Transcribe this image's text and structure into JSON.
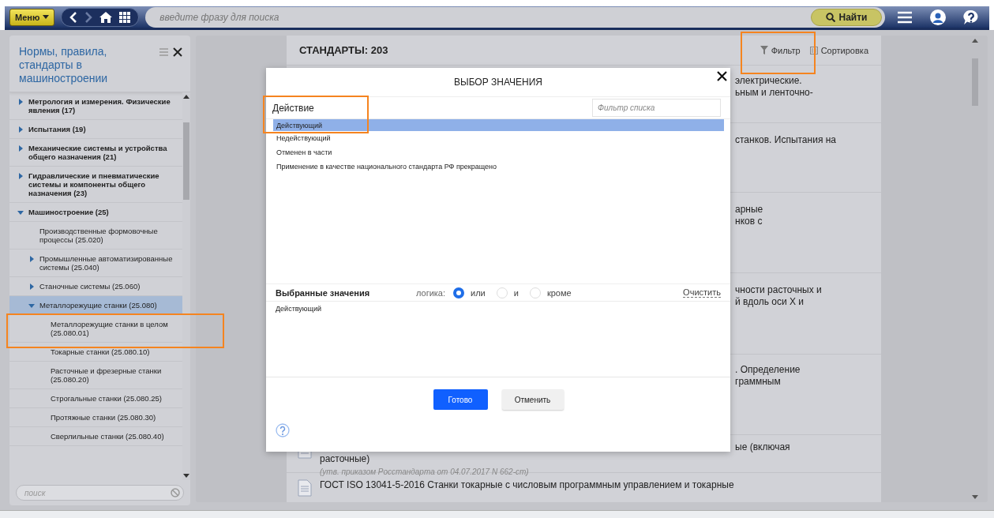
{
  "topbar": {
    "menu_label": "Меню",
    "search": {
      "placeholder": "введите фразу для поиска"
    },
    "find_label": "Найти"
  },
  "sidebar": {
    "title": "Нормы, правила, стандарты в машиностроении",
    "search": {
      "placeholder": "поиск"
    },
    "items": [
      {
        "label": "Метрология и измерения. Физические явления (17)",
        "expanded": false,
        "selected": false
      },
      {
        "label": "Испытания (19)",
        "expanded": false,
        "selected": false
      },
      {
        "label": "Механические системы и устройства общего назначения (21)",
        "expanded": false,
        "selected": false
      },
      {
        "label": "Гидравлические и пневматические системы и компоненты общего назначения (23)",
        "expanded": false,
        "selected": false
      },
      {
        "label": "Машиностроение (25)",
        "expanded": true,
        "selected": false,
        "children": [
          {
            "label": "Производственные формовочные процессы (25.020)",
            "selected": false
          },
          {
            "label": "Промышленные автоматизированные системы (25.040)",
            "expanded": false,
            "selected": false
          },
          {
            "label": "Станочные системы (25.060)",
            "expanded": false,
            "selected": false
          },
          {
            "label": "Металлорежущие станки (25.080)",
            "expanded": true,
            "selected": true,
            "children": [
              {
                "label": "Металлорежущие станки в целом (25.080.01)",
                "selected": false
              },
              {
                "label": "Токарные станки (25.080.10)",
                "selected": false
              },
              {
                "label": "Расточные и фрезерные станки (25.080.20)",
                "selected": false
              },
              {
                "label": "Строгальные станки (25.080.25)",
                "selected": false
              },
              {
                "label": "Протяжные станки (25.080.30)",
                "selected": false
              },
              {
                "label": "Сверлильные станки (25.080.40)",
                "selected": false
              }
            ]
          }
        ]
      }
    ]
  },
  "list": {
    "title": "СТАНДАРТЫ: 203",
    "filter_label": "Фильтр",
    "sort_label": "Сортировка",
    "rows": [
      {
        "fragment_lines": [
          "электрические.",
          "ьным и ленточно-"
        ]
      },
      {
        "fragment_lines": [
          "станков. Испытания на"
        ]
      },
      {
        "fragment_lines": [
          "арные",
          "нков с"
        ]
      },
      {
        "fragment_lines": [
          "чности расточных и",
          "й вдоль оси X и"
        ]
      },
      {
        "fragment_lines": [
          ". Определение",
          "граммным"
        ]
      },
      {
        "fragment_lines": [
          "ые (включая"
        ],
        "title": "расточные)",
        "note": "(утв. приказом Росстандарта от 04.07.2017 N 662-ст)"
      },
      {
        "title": "ГОСТ ISO 13041-5-2016 Станки токарные с числовым программным управлением и токарные"
      }
    ]
  },
  "dialog": {
    "title": "ВЫБОР ЗНАЧЕНИЯ",
    "field_label": "Действие",
    "filter": {
      "placeholder": "Фильтр списка"
    },
    "options": [
      {
        "label": "Действующий",
        "selected": true
      },
      {
        "label": "Недействующий",
        "selected": false
      },
      {
        "label": "Отменен в части",
        "selected": false
      },
      {
        "label": "Применение в качестве национального стандарта РФ прекращено",
        "selected": false
      }
    ],
    "selected_title": "Выбранные значения",
    "logic_label": "логика:",
    "logic": [
      {
        "label": "или",
        "selected": true
      },
      {
        "label": "и",
        "selected": false
      },
      {
        "label": "кроме",
        "selected": false
      }
    ],
    "clear_label": "Очистить",
    "selected_values": [
      "Действующий"
    ],
    "ok_label": "Готово",
    "cancel_label": "Отменить"
  }
}
